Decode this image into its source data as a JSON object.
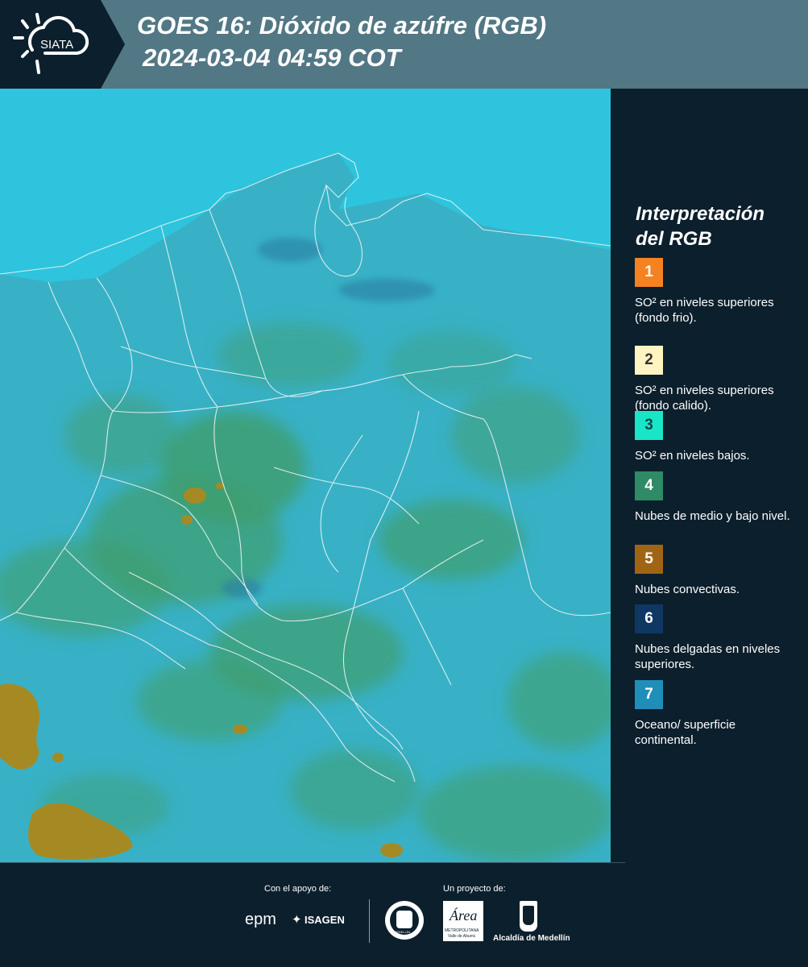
{
  "header": {
    "logo_text": "SIATA",
    "title_line1": "GOES 16: Dióxido de azúfre (RGB)",
    "title_line2": "2024-03-04 04:59 COT",
    "background_color": "#527785"
  },
  "legend": {
    "title_line1": "Interpretación",
    "title_line2": "del RGB",
    "items": [
      {
        "number": "1",
        "color": "#f58220",
        "text_color": "#ffffff",
        "description": "SO² en niveles superiores (fondo frio)."
      },
      {
        "number": "2",
        "color": "#fff4c2",
        "text_color": "#333333",
        "description": "SO² en niveles superiores (fondo calido)."
      },
      {
        "number": "3",
        "color": "#19e6c6",
        "text_color": "#0c4a4a",
        "description": "SO² en niveles bajos."
      },
      {
        "number": "4",
        "color": "#2f8a66",
        "text_color": "#ffffff",
        "description": "Nubes de medio y bajo nivel."
      },
      {
        "number": "5",
        "color": "#a06514",
        "text_color": "#ffffff",
        "description": "Nubes convectivas."
      },
      {
        "number": "6",
        "color": "#0f3764",
        "text_color": "#ffffff",
        "description": "Nubes delgadas en niveles superiores."
      },
      {
        "number": "7",
        "color": "#1f8fb9",
        "text_color": "#ffffff",
        "description": "Oceano/ superficie continental."
      }
    ]
  },
  "map": {
    "ocean_color": "#2ec4dd",
    "land_color": "#3ba9ba",
    "cloud_color": "#3f9e6d",
    "convective_color": "#a58a23",
    "border_color": "#e9f3f5"
  },
  "footer": {
    "support_label": "Con el apoyo de:",
    "project_label": "Un proyecto de:",
    "sponsor1": "epm",
    "sponsor2": "ISAGEN",
    "partner1": "MEDELLÍN",
    "partner2_name": "Área",
    "partner2_line1": "METROPOLITANA",
    "partner2_line2": "Valle de Aburrá",
    "partner3": "Alcaldía de Medellín"
  }
}
